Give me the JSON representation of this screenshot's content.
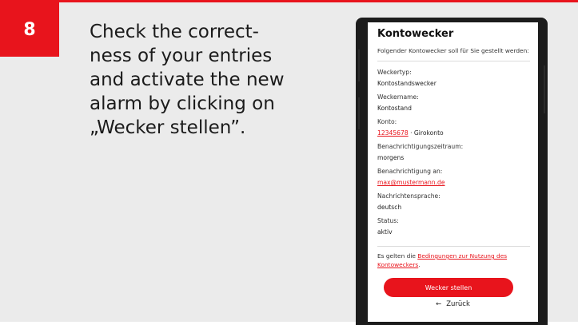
{
  "step": {
    "number": "8"
  },
  "instruction": {
    "lines": [
      "Check the correct-",
      "ness of your entries",
      "and activate the new",
      "alarm by clicking on",
      "„Wecker stellen”."
    ]
  },
  "screen": {
    "title": "Kontowecker",
    "subtitle": "Folgender Kontowecker soll für Sie gestellt werden:",
    "fields": [
      {
        "label": "Weckertyp:",
        "value": "Kontostandswecker"
      },
      {
        "label": "Weckername:",
        "value": "Kontostand"
      },
      {
        "label": "Konto:",
        "value_link": "12345678",
        "value_suffix": " · Girokonto"
      },
      {
        "label": "Benachrichtigungszeitraum:",
        "value": "morgens"
      },
      {
        "label": "Benachrichtigung an:",
        "value_link": "max@mustermann.de"
      },
      {
        "label": "Nachrichtensprache:",
        "value": "deutsch"
      },
      {
        "label": "Status:",
        "value": "aktiv"
      }
    ],
    "terms_prefix": "Es gelten die ",
    "terms_link": "Bedingungen zur Nutzung des Kontoweckers",
    "terms_suffix": ".",
    "cta_label": "Wecker stellen",
    "back_icon": "←",
    "back_label": "Zurück"
  },
  "colors": {
    "accent": "#e8141c",
    "background": "#ebebeb"
  }
}
